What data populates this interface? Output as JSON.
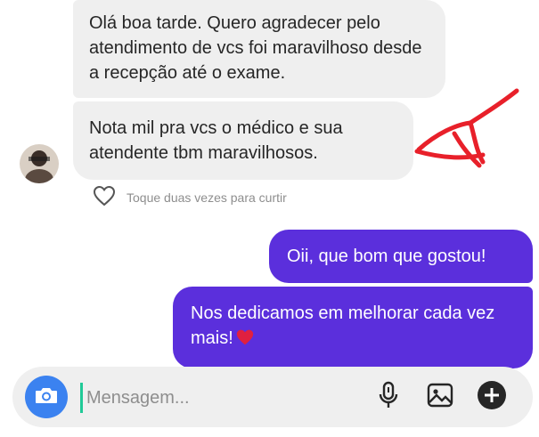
{
  "messages": [
    {
      "direction": "incoming",
      "text": "Olá boa tarde. Quero agradecer pelo atendimento de vcs foi maravilhoso desde a recepção até o exame."
    },
    {
      "direction": "incoming",
      "text": "Nota mil pra vcs o médico e sua atendente tbm maravilhosos."
    },
    {
      "direction": "outgoing",
      "text": "Oii, que bom que gostou!"
    },
    {
      "direction": "outgoing",
      "text": "Nos dedicamos em melhorar cada vez mais!"
    }
  ],
  "reaction_hint": "Toque duas vezes para curtir",
  "composer": {
    "placeholder": "Mensagem..."
  },
  "colors": {
    "outgoing_bubble": "#5b2fdc",
    "incoming_bubble": "#efefef",
    "camera_button": "#3b82f0",
    "annotation": "#e8202a"
  },
  "icons": [
    "avatar",
    "heart-icon",
    "camera-icon",
    "microphone-icon",
    "gallery-icon",
    "plus-icon",
    "red-heart-emoji"
  ]
}
